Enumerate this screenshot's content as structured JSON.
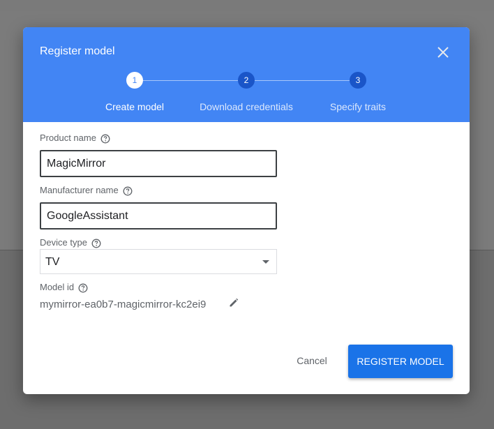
{
  "dialog": {
    "title": "Register model",
    "close_icon": "close-icon"
  },
  "stepper": {
    "steps": [
      {
        "number": "1",
        "label": "Create model",
        "state": "active"
      },
      {
        "number": "2",
        "label": "Download credentials",
        "state": "inactive"
      },
      {
        "number": "3",
        "label": "Specify traits",
        "state": "inactive"
      }
    ]
  },
  "form": {
    "product_name": {
      "label": "Product name",
      "value": "MagicMirror",
      "help_icon": "help-icon"
    },
    "manufacturer_name": {
      "label": "Manufacturer name",
      "value": "GoogleAssistant",
      "help_icon": "help-icon"
    },
    "device_type": {
      "label": "Device type",
      "selected": "TV",
      "help_icon": "help-icon"
    },
    "model_id": {
      "label": "Model id",
      "value": "mymirror-ea0b7-magicmirror-kc2ei9",
      "edit_icon": "pencil-icon",
      "help_icon": "help-icon"
    }
  },
  "actions": {
    "cancel_label": "Cancel",
    "register_label": "REGISTER MODEL"
  },
  "colors": {
    "header": "#4285f4",
    "primary_button": "#1a73e8",
    "inactive_step": "#1a55c8"
  }
}
